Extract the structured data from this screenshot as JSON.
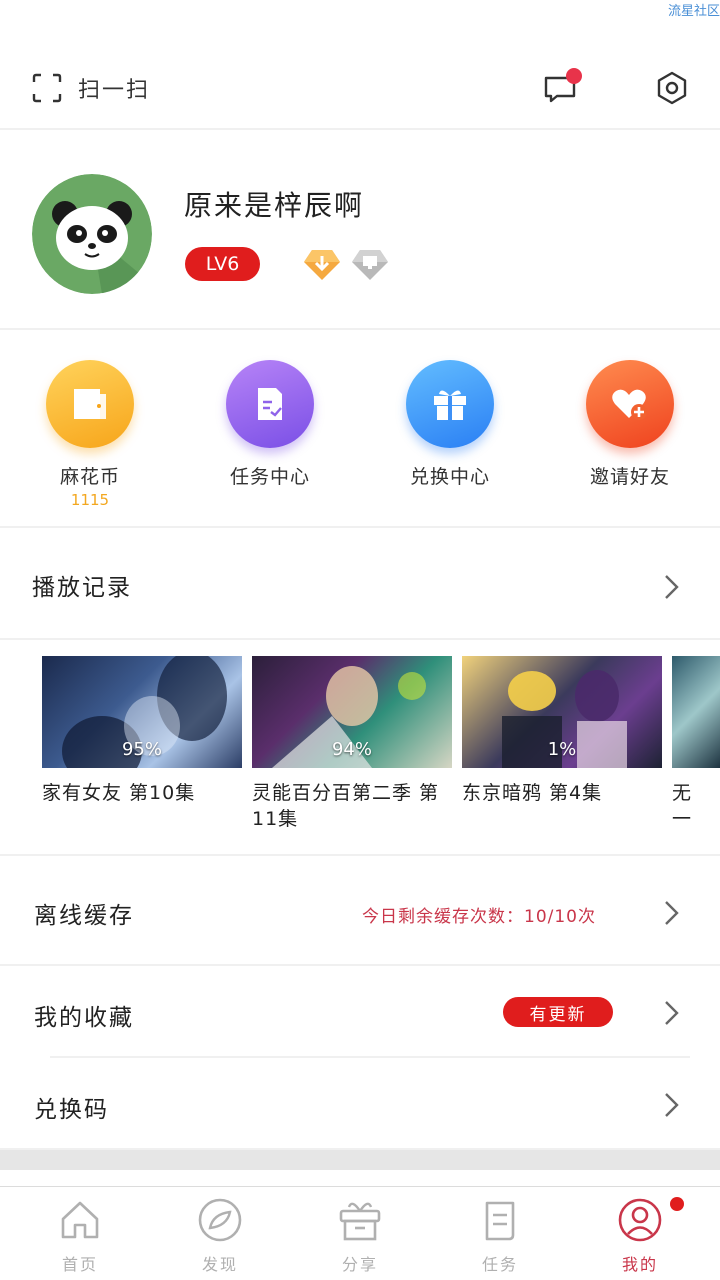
{
  "status": {
    "text": "流星社区"
  },
  "topbar": {
    "scan_label": "扫一扫"
  },
  "profile": {
    "username": "原来是梓辰啊",
    "level": "LV6"
  },
  "quick_actions": [
    {
      "label": "麻花币",
      "sub": "1115",
      "icon": "wallet-icon",
      "color_from": "#ffcf4a",
      "color_to": "#f9a91b"
    },
    {
      "label": "任务中心",
      "icon": "task-doc-icon",
      "color_from": "#b37bf7",
      "color_to": "#7b4fe8"
    },
    {
      "label": "兑换中心",
      "icon": "gift-icon",
      "color_from": "#5fb8ff",
      "color_to": "#2a82f5"
    },
    {
      "label": "邀请好友",
      "icon": "heart-plus-icon",
      "color_from": "#ff8a4d",
      "color_to": "#f1471f"
    }
  ],
  "history": {
    "title": "播放记录",
    "items": [
      {
        "title": "家有女友 第10集",
        "progress": "95%"
      },
      {
        "title": "灵能百分百第二季 第11集",
        "progress": "94%"
      },
      {
        "title": "东京暗鸦 第4集",
        "progress": "1%"
      },
      {
        "title": "无一"
      }
    ]
  },
  "offline": {
    "title": "离线缓存",
    "note": "今日剩余缓存次数：10/10次"
  },
  "favorites": {
    "title": "我的收藏",
    "badge": "有更新"
  },
  "redeem": {
    "title": "兑换码"
  },
  "nav": [
    {
      "label": "首页",
      "icon": "home-icon"
    },
    {
      "label": "发现",
      "icon": "discover-icon"
    },
    {
      "label": "分享",
      "icon": "share-box-icon"
    },
    {
      "label": "任务",
      "icon": "task-icon"
    },
    {
      "label": "我的",
      "icon": "profile-icon",
      "active": true
    }
  ],
  "colors": {
    "accent": "#e01d1d",
    "nav_active": "#c9364a",
    "coin": "#f3a71f"
  }
}
